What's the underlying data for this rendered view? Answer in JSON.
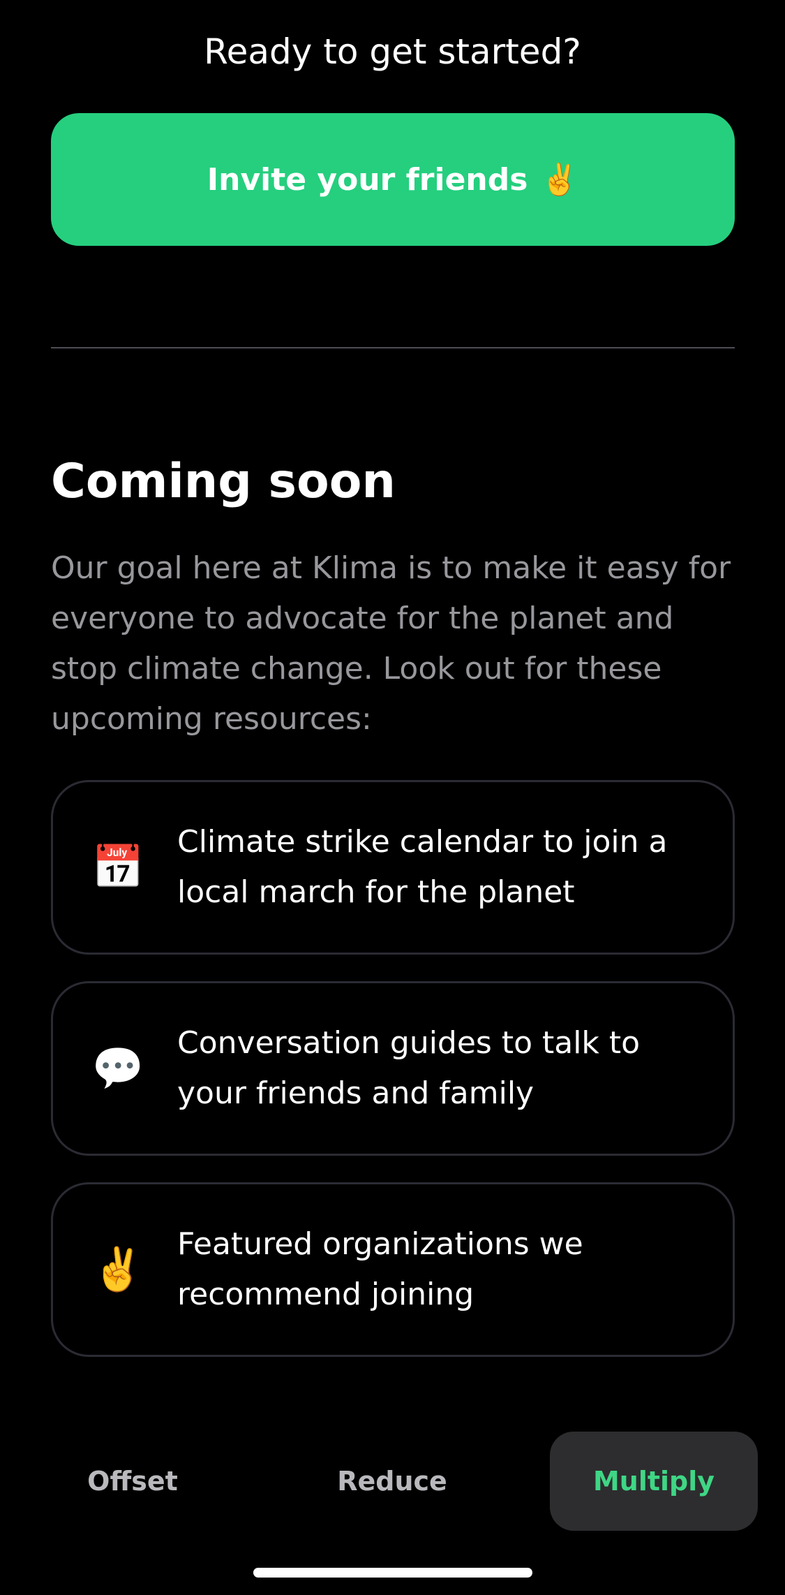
{
  "header": {
    "ready_text": "Ready to get started?"
  },
  "invite": {
    "label": "Invite your friends",
    "emoji": "✌️"
  },
  "coming_soon": {
    "title": "Coming soon",
    "description": "Our goal here at Klima is to make it easy for everyone to advocate for the planet and stop climate change. Look out for these upcoming resources:",
    "items": [
      {
        "icon": "calendar-icon",
        "glyph": "📅",
        "text": "Climate strike calendar to join a local march for the planet"
      },
      {
        "icon": "speech-bubble-icon",
        "glyph": "💬",
        "text": "Conversation guides to talk to your friends and family"
      },
      {
        "icon": "victory-hand-icon",
        "glyph": "✌️",
        "text": "Featured organizations we recommend joining"
      }
    ]
  },
  "tabbar": {
    "tabs": [
      {
        "label": "Offset",
        "active": false
      },
      {
        "label": "Reduce",
        "active": false
      },
      {
        "label": "Multiply",
        "active": true
      }
    ]
  },
  "colors": {
    "background": "#000000",
    "accent_green": "#25cf7e",
    "active_tab_text": "#3fd685",
    "muted_text": "#97979c",
    "card_border": "#2b2b34"
  }
}
